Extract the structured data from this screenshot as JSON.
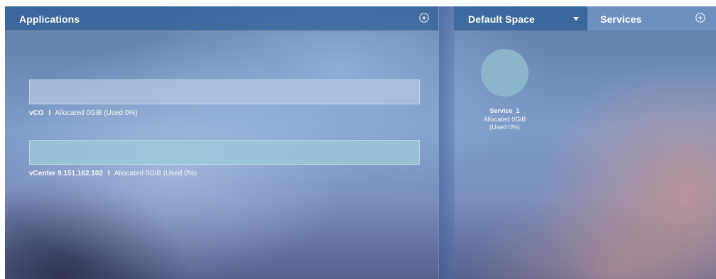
{
  "applications_panel": {
    "title": "Applications",
    "add_icon": "add-circle-icon",
    "items": [
      {
        "name": "vCO",
        "separator": "I",
        "allocation": "Allocated 0GiB (Used 0%)",
        "bar_color": "#b3c5e2",
        "used_fraction": 0
      },
      {
        "name": "vCenter 9.151.162.102",
        "separator": "I",
        "allocation": "Allocated 0GiB (Used 0%)",
        "bar_color": "#9ccbd9",
        "used_fraction": 0
      }
    ]
  },
  "space_panel": {
    "space_selector": "Default Space",
    "chevron_icon": "chevron-down-icon",
    "services_tab": "Services",
    "add_icon": "add-circle-icon",
    "services": [
      {
        "name": "Service_1",
        "allocated": "Allocated 0GiB",
        "used": "(Used 0%)",
        "color": "#8ab5cb"
      }
    ]
  }
}
